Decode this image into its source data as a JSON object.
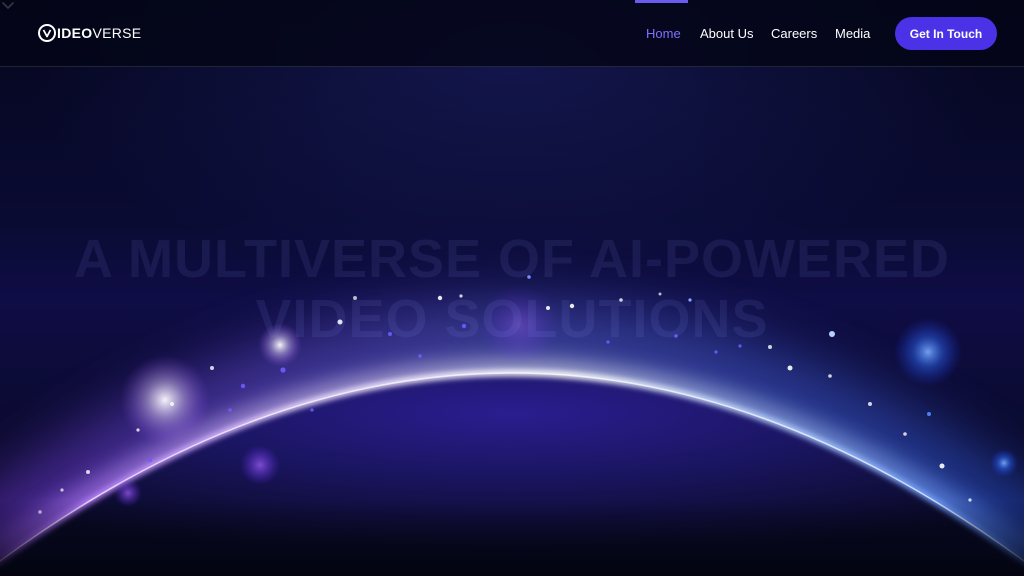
{
  "brand": {
    "logo_bold": "IDEO",
    "logo_light": "VERSE"
  },
  "nav": {
    "items": [
      {
        "label": "Home",
        "active": true
      },
      {
        "label": "About Us",
        "active": false
      },
      {
        "label": "Careers",
        "active": false
      },
      {
        "label": "Media",
        "active": false
      }
    ],
    "cta_label": "Get In Touch"
  },
  "hero": {
    "headline_line1": "A MULTIVERSE OF AI-POWERED",
    "headline_line2": "VIDEO SOLUTIONS",
    "scroll_icon": "chevron-down-icon"
  },
  "colors": {
    "accent": "#4b32e6",
    "active_nav": "#7b73ff",
    "background": "#05061a",
    "glow_violet": "#9b4dff",
    "glow_blue": "#3a6bff"
  }
}
